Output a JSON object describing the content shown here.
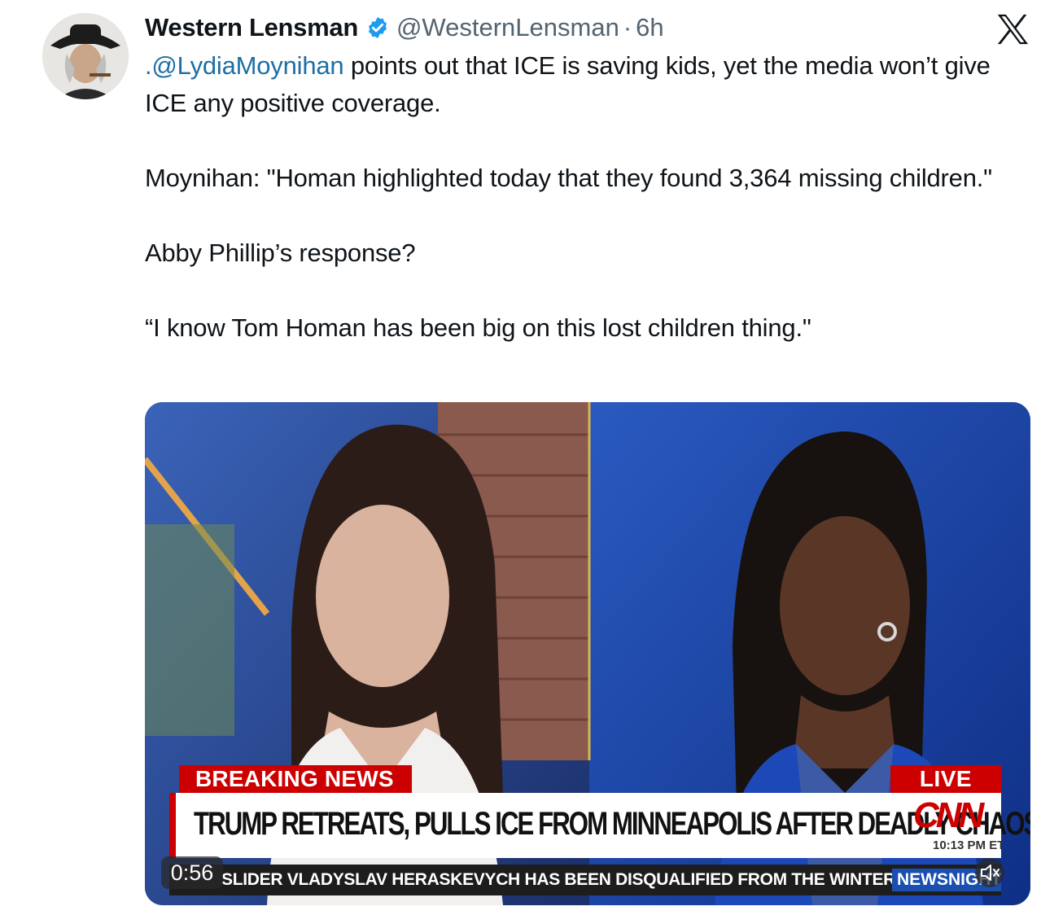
{
  "tweet": {
    "author_name": "Western Lensman",
    "handle": "@WesternLensman",
    "separator": "·",
    "time": "6h",
    "mention": ".@LydiaMoynihan",
    "line1_rest": " points out that ICE is saving kids, yet the media won’t give ICE any positive coverage.",
    "para2": "Moynihan: \"Homan highlighted today that they found 3,364 missing children.\"",
    "para3": "Abby Phillip’s response?",
    "para4": "“I know Tom Homan has been big on this lost children thing.\""
  },
  "video": {
    "breaking_label": "BREAKING NEWS",
    "live_label": "LIVE",
    "headline": "TRUMP RETREATS, PULLS ICE FROM MINNEAPOLIS AFTER DEADLY CHAOS",
    "network_logo": "CNN",
    "broadcast_time": "10:13 PM ET",
    "ticker": "SLIDER VLADYSLAV HERASKEVYCH HAS BEEN DISQUALIFIED FROM THE WINTER",
    "ticker_brand": "NEWSNIGHT",
    "duration": "0:56"
  },
  "icons": {
    "verified": "verified-badge-icon",
    "x": "x-logo-icon",
    "mute": "muted-speaker-icon"
  },
  "colors": {
    "verified_blue": "#1d9bf0",
    "link_blue": "#1d6fa5",
    "cnn_red": "#cc0000",
    "secondary_text": "#536471"
  }
}
